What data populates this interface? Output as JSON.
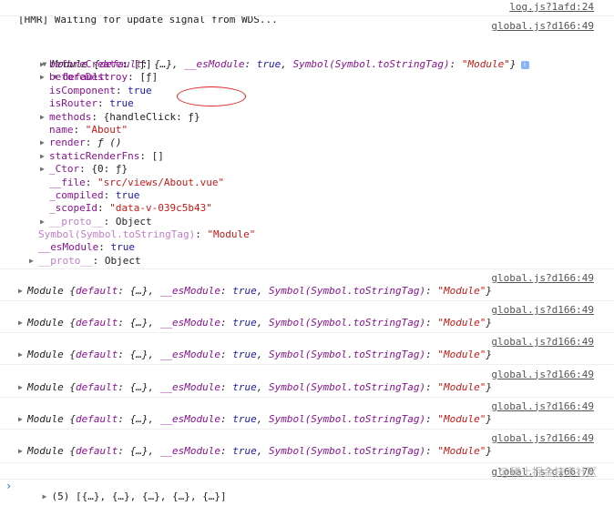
{
  "hmr_message": "[HMR] Waiting for update signal from WDS...",
  "hmr_source": "log.js?1afd:24",
  "source_link": "global.js?d166:49",
  "last_source_link": "global.js?d166:70",
  "module_summary": {
    "prefix": "Module {",
    "default_key": "default",
    "default_val": "{…}",
    "esmodule_key": "__esModule",
    "esmodule_val": "true",
    "symbol_key": "Symbol(Symbol.toStringTag)",
    "symbol_val": "\"Module\"",
    "close": "}",
    "info_icon": "i"
  },
  "expanded": {
    "default_label": "default:",
    "props": [
      {
        "key": "beforeCreate",
        "val": "[ƒ]",
        "type": "plain",
        "expandable": true
      },
      {
        "key": "beforeDestroy",
        "val": "[ƒ]",
        "type": "plain",
        "expandable": true
      },
      {
        "key": "isComponent",
        "val": "true",
        "type": "bool",
        "expandable": false
      },
      {
        "key": "isRouter",
        "val": "true",
        "type": "bool",
        "expandable": false
      },
      {
        "key": "methods",
        "val": "{handleClick: ƒ}",
        "type": "plain",
        "expandable": true
      },
      {
        "key": "name",
        "val": "\"About\"",
        "type": "str",
        "expandable": false
      },
      {
        "key": "render",
        "val": "ƒ ()",
        "type": "fn",
        "expandable": true
      },
      {
        "key": "staticRenderFns",
        "val": "[]",
        "type": "plain",
        "expandable": true
      },
      {
        "key": "_Ctor",
        "val": "{0: ƒ}",
        "type": "plain",
        "expandable": true
      },
      {
        "key": "__file",
        "val": "\"src/views/About.vue\"",
        "type": "str",
        "expandable": false
      },
      {
        "key": "_compiled",
        "val": "true",
        "type": "bool",
        "expandable": false
      },
      {
        "key": "_scopeId",
        "val": "\"data-v-039c5b43\"",
        "type": "str",
        "expandable": false
      },
      {
        "key": "__proto__",
        "val": "Object",
        "type": "plain",
        "expandable": true,
        "dim": true
      }
    ],
    "module_props": [
      {
        "key": "Symbol(Symbol.toStringTag)",
        "val": "\"Module\"",
        "type": "str",
        "expandable": false,
        "dim": true
      },
      {
        "key": "__esModule",
        "val": "true",
        "type": "bool",
        "expandable": false
      },
      {
        "key": "__proto__",
        "val": "Object",
        "type": "plain",
        "expandable": true,
        "dim": true
      }
    ]
  },
  "array_summary": {
    "count": "(5)",
    "items": "[{…}, {…}, {…}, {…}, {…}]"
  },
  "watermark": "@稀土掘金技术社区",
  "prompt_symbol": "›",
  "icons": {
    "expand": "triangle-right-icon",
    "collapse": "triangle-down-icon",
    "info": "info-icon",
    "prompt": "chevron-right-icon"
  }
}
